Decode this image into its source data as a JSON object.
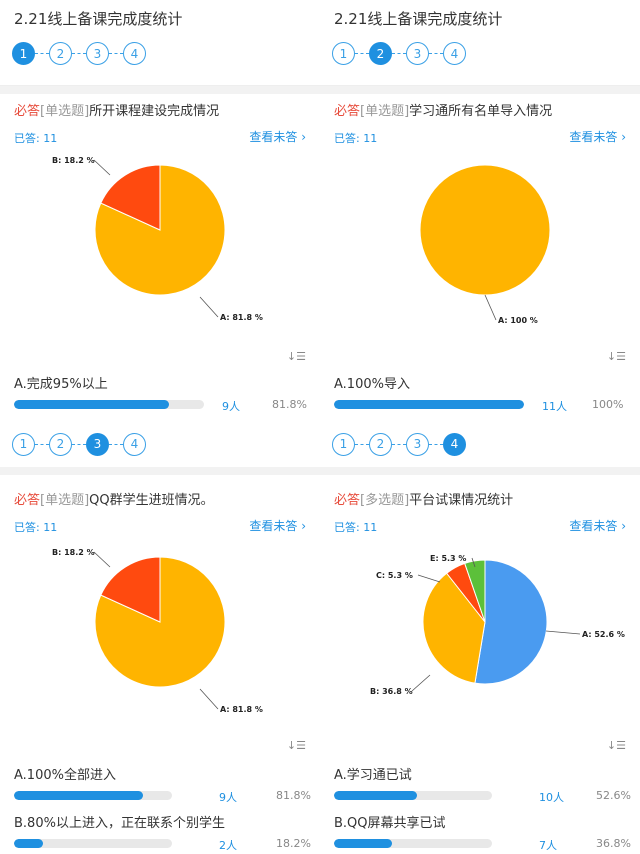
{
  "page": {
    "title": "2.21线上备课完成度统计"
  },
  "panels": [
    {
      "active_step": 2,
      "steps": [
        "1",
        "2",
        "3",
        "4"
      ],
      "question": {
        "required": "必答",
        "type": "[单选题]",
        "title": "所开课程建设完成情况"
      },
      "answered": "已答: 11",
      "view_unanswered": "查看未答 ›",
      "chart_data": {
        "type": "pie",
        "slices": [
          {
            "label": "A: 81.8 %",
            "value": 81.8,
            "color": "#FFB400"
          },
          {
            "label": "B: 18.2 %",
            "value": 18.2,
            "color": "#FF4A0F"
          }
        ]
      },
      "options": [
        {
          "label": "A.完成95%以上",
          "fraction": 0.818,
          "count": "9人",
          "percent": "81.8%"
        }
      ]
    },
    {
      "active_step": 2,
      "steps": [
        "1",
        "2",
        "3",
        "4"
      ],
      "question": {
        "required": "必答",
        "type": "[单选题]",
        "title": "学习通所有名单导入情况"
      },
      "answered": "已答: 11",
      "view_unanswered": "查看未答 ›",
      "chart_data": {
        "type": "pie",
        "slices": [
          {
            "label": "A: 100 %",
            "value": 100,
            "color": "#FFB400"
          }
        ]
      },
      "options": [
        {
          "label": "A.100%导入",
          "fraction": 1.0,
          "count": "11人",
          "percent": "100%"
        }
      ]
    },
    {
      "active_step": 3,
      "steps": [
        "1",
        "2",
        "3",
        "4"
      ],
      "question": {
        "required": "必答",
        "type": "[单选题]",
        "title": "QQ群学生进班情况。"
      },
      "answered": "已答: 11",
      "view_unanswered": "查看未答 ›",
      "chart_data": {
        "type": "pie",
        "slices": [
          {
            "label": "A: 81.8 %",
            "value": 81.8,
            "color": "#FFB400"
          },
          {
            "label": "B: 18.2 %",
            "value": 18.2,
            "color": "#FF4A0F"
          }
        ]
      },
      "options": [
        {
          "label": "A.100%全部进入",
          "fraction": 0.818,
          "count": "9人",
          "percent": "81.8%"
        },
        {
          "label": "B.80%以上进入，正在联系个别学生",
          "fraction": 0.182,
          "count": "2人",
          "percent": "18.2%"
        }
      ]
    },
    {
      "active_step": 4,
      "steps": [
        "1",
        "2",
        "3",
        "4"
      ],
      "question": {
        "required": "必答",
        "type": "[多选题]",
        "title": "平台试课情况统计"
      },
      "answered": "已答: 11",
      "view_unanswered": "查看未答 ›",
      "chart_data": {
        "type": "pie",
        "slices": [
          {
            "label": "A: 52.6 %",
            "value": 52.6,
            "color": "#4A9BF0"
          },
          {
            "label": "B: 36.8 %",
            "value": 36.8,
            "color": "#FFB400"
          },
          {
            "label": "C: 5.3 %",
            "value": 5.3,
            "color": "#FF4A0F"
          },
          {
            "label": "E: 5.3 %",
            "value": 5.3,
            "color": "#5CC03A"
          }
        ]
      },
      "options": [
        {
          "label": "A.学习通已试",
          "fraction": 0.526,
          "count": "10人",
          "percent": "52.6%"
        },
        {
          "label": "B.QQ屏幕共享已试",
          "fraction": 0.368,
          "count": "7人",
          "percent": "36.8%"
        }
      ]
    }
  ],
  "sort_icon": "sort-desc-icon",
  "sort_glyph": "↓☰"
}
